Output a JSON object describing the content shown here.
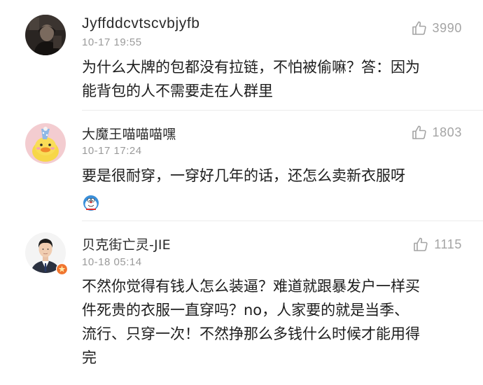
{
  "comments": [
    {
      "username": "Jyffddcvtscvbjyfb",
      "timestamp": "10-17 19:55",
      "likes": "3990",
      "lines": [
        "为什么大牌的包都没有拉链，不怕被偷嘛？答：因为",
        "能背包的人不需要走在人群里"
      ],
      "avatar_icon": "dark-portrait-avatar"
    },
    {
      "username": "大魔王喵喵喵嘿",
      "timestamp": "10-17 17:24",
      "likes": "1803",
      "lines": [
        "要是很耐穿，一穿好几年的话，还怎么卖新衣服呀"
      ],
      "emoji_icon": "doraemon-emoji-icon",
      "avatar_icon": "yellow-duck-party-hat-avatar"
    },
    {
      "username": "贝克街亡灵-JIE",
      "timestamp": "10-18 05:14",
      "likes": "1115",
      "lines": [
        "不然你觉得有钱人怎么装逼？难道就跟暴发户一样买",
        "件死贵的衣服一直穿吗？no，人家要的就是当季、",
        "流行、只穿一次！不然挣那么多钱什么时候才能用得",
        "完"
      ],
      "avatar_icon": "man-in-suit-avatar",
      "badge_icon": "verified-badge-icon"
    }
  ],
  "colors": {
    "text": "#1d1d1d",
    "username": "#2b2b2b",
    "meta": "#9a9a9a",
    "like": "#a4a4a4",
    "divider": "#ececec",
    "badge": "#f0742e"
  }
}
